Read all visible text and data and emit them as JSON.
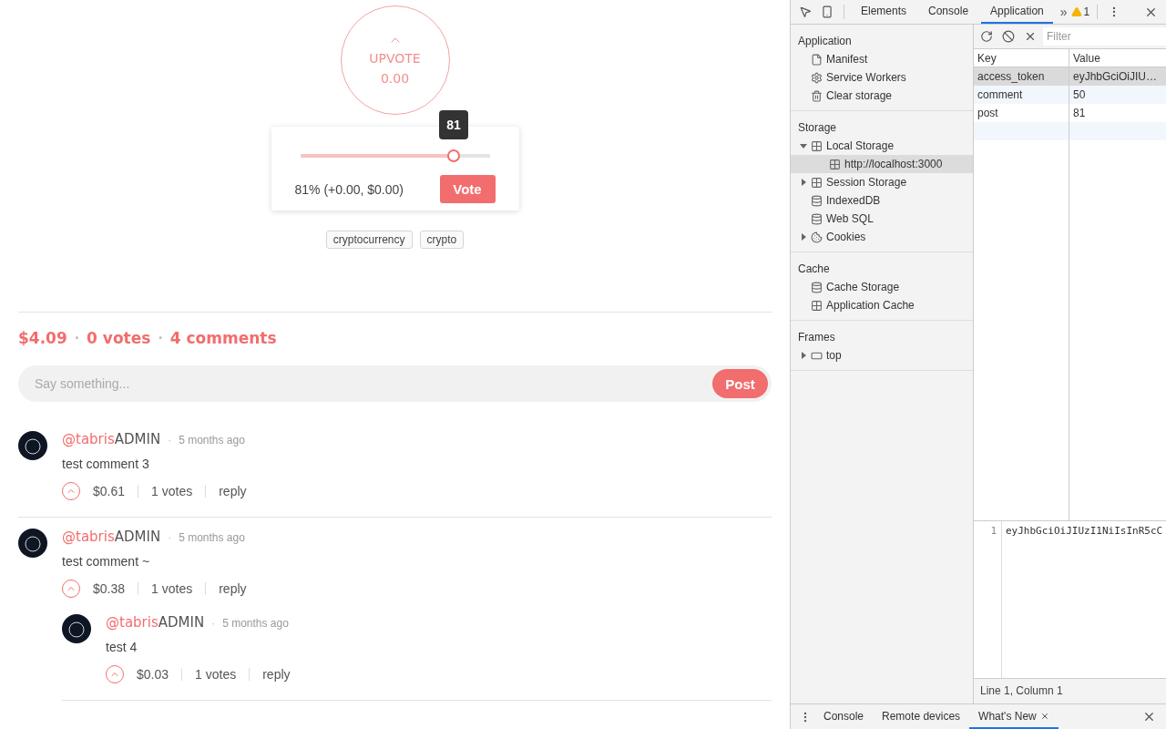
{
  "post": {
    "upvote": {
      "label": "UPVOTE",
      "amount": "0.00"
    },
    "vote_popup": {
      "tooltip": "81",
      "level": 0.81,
      "summary": "81% (+0.00, $0.00)",
      "button": "Vote"
    },
    "tags": [
      "cryptocurrency",
      "crypto"
    ],
    "stats": [
      "$4.09",
      "0 votes",
      "4 comments"
    ],
    "stats_separator": "·",
    "comment_box": {
      "placeholder": "Say something...",
      "button": "Post"
    }
  },
  "comments": [
    {
      "user": "@tabris",
      "badge": "ADMIN",
      "separator": "·",
      "time": "5 months ago",
      "text": "test comment 3",
      "payout": "$0.61",
      "votes": "1 votes",
      "reply": "reply"
    },
    {
      "user": "@tabris",
      "badge": "ADMIN",
      "separator": "·",
      "time": "5 months ago",
      "text": "test comment ~",
      "payout": "$0.38",
      "votes": "1 votes",
      "reply": "reply",
      "children": [
        {
          "user": "@tabris",
          "badge": "ADMIN",
          "separator": "·",
          "time": "5 months ago",
          "text": "test 4",
          "payout": "$0.03",
          "votes": "1 votes",
          "reply": "reply"
        }
      ]
    }
  ],
  "devtools": {
    "tabs": [
      {
        "label": "Elements",
        "selected": false
      },
      {
        "label": "Console",
        "selected": false
      },
      {
        "label": "Application",
        "selected": true
      }
    ],
    "overflow": "»",
    "warning_count": "1",
    "sidebar": [
      {
        "title": "Application",
        "items": [
          {
            "label": "Manifest",
            "kind": "file",
            "selected": false
          },
          {
            "label": "Service Workers",
            "kind": "gear",
            "selected": false
          },
          {
            "label": "Clear storage",
            "kind": "trash",
            "selected": false
          }
        ]
      },
      {
        "title": "Storage",
        "items": [
          {
            "label": "Local Storage",
            "kind": "grid",
            "selected": false,
            "expanded": true,
            "children": [
              {
                "label": "http://localhost:3000",
                "kind": "grid",
                "selected": true
              }
            ]
          },
          {
            "label": "Session Storage",
            "kind": "grid",
            "selected": false,
            "expanded": false
          },
          {
            "label": "IndexedDB",
            "kind": "database",
            "selected": false
          },
          {
            "label": "Web SQL",
            "kind": "database",
            "selected": false
          },
          {
            "label": "Cookies",
            "kind": "cookie",
            "selected": false,
            "expanded": false
          }
        ]
      },
      {
        "title": "Cache",
        "items": [
          {
            "label": "Cache Storage",
            "kind": "database",
            "selected": false
          },
          {
            "label": "Application Cache",
            "kind": "grid",
            "selected": false
          }
        ]
      },
      {
        "title": "Frames",
        "items": [
          {
            "label": "top",
            "kind": "frame",
            "selected": false,
            "expanded": false
          }
        ]
      }
    ],
    "filter": {
      "placeholder": "Filter"
    },
    "table": {
      "columns": [
        "Key",
        "Value"
      ],
      "rows": [
        {
          "key": "access_token",
          "value": "eyJhbGciOiJIU…",
          "selected": true
        },
        {
          "key": "comment",
          "value": "50",
          "selected": false
        },
        {
          "key": "post",
          "value": "81",
          "selected": false
        }
      ]
    },
    "preview": {
      "line_number": "1",
      "code": "eyJhbGciOiJIUzI1NiIsInR5cC"
    },
    "status": "Line 1, Column 1",
    "drawer_tabs": [
      {
        "label": "Console",
        "selected": false
      },
      {
        "label": "Remote devices",
        "selected": false
      },
      {
        "label": "What's New",
        "selected": true,
        "closable": true
      }
    ]
  }
}
